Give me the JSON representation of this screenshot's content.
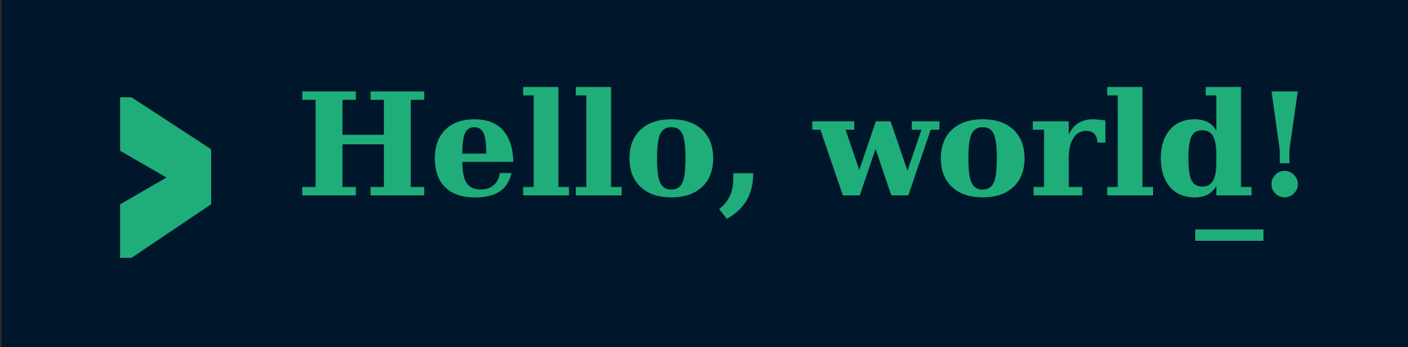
{
  "banner": {
    "message": "Hello, world!",
    "icon": "chevron-right-icon",
    "cursor": "underscore-cursor",
    "colors": {
      "background": "#00162b",
      "accent": "#1fae7a"
    }
  }
}
